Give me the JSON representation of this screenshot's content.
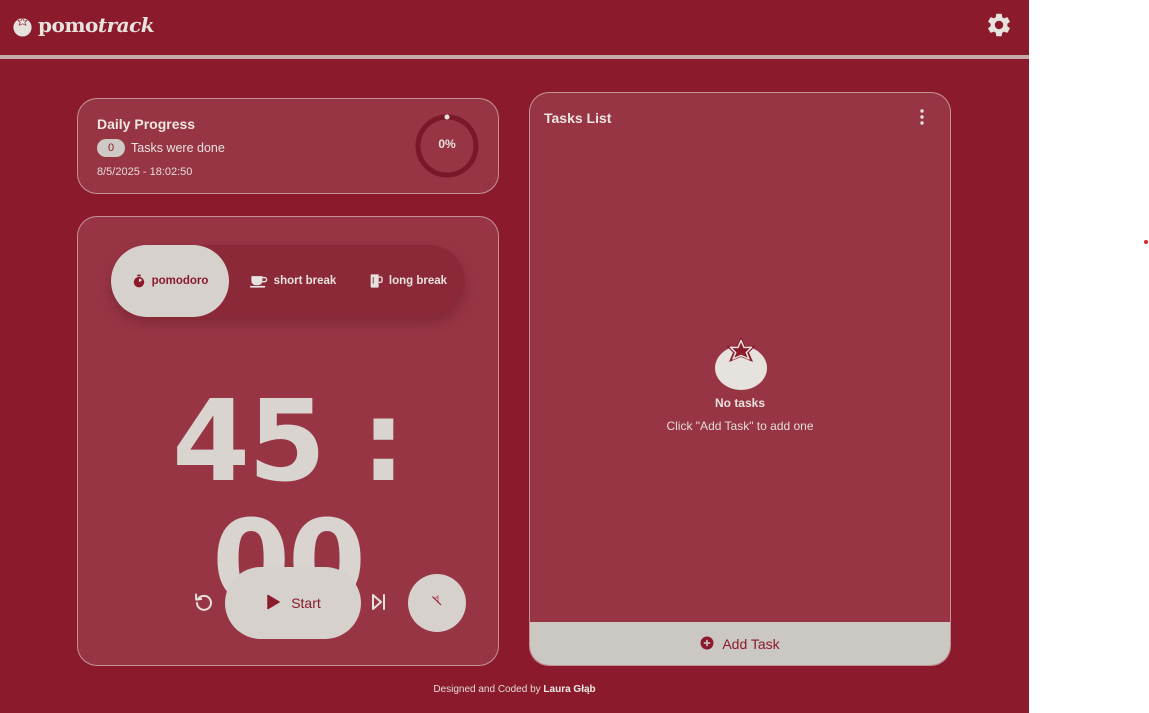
{
  "brand": {
    "name_regular": "pomo",
    "name_italic": "track"
  },
  "colors": {
    "primary": "#8a1a2c",
    "surface": "#d6d1cd",
    "text": "#e6e2dd"
  },
  "icons": {
    "brand": "tomato-icon",
    "settings": "gear-icon",
    "menu": "kebab-menu-icon",
    "reset": "reset-icon",
    "start": "play-icon",
    "skip": "skip-next-icon",
    "sound": "sound-icon",
    "add": "plus-circle-icon"
  },
  "progress": {
    "title": "Daily Progress",
    "tasks_done": "0",
    "tasks_label": "Tasks were done",
    "datetime": "8/5/2025 - 18:02:50",
    "percent_label": "0%",
    "percent_value": 0
  },
  "timer": {
    "modes": [
      {
        "label": "pomodoro",
        "icon": "timer-icon",
        "active": true
      },
      {
        "label": "short break",
        "icon": "coffee-cup-icon",
        "active": false
      },
      {
        "label": "long break",
        "icon": "coffee-mug-icon",
        "active": false
      }
    ],
    "time": "45 : 00",
    "start_label": "Start"
  },
  "tasks": {
    "title": "Tasks List",
    "empty_title": "No tasks",
    "empty_subtitle": "Click \"Add Task\" to add one",
    "add_label": "Add Task"
  },
  "footer": {
    "prefix": "Designed and Coded by",
    "author": "Laura Głąb"
  }
}
